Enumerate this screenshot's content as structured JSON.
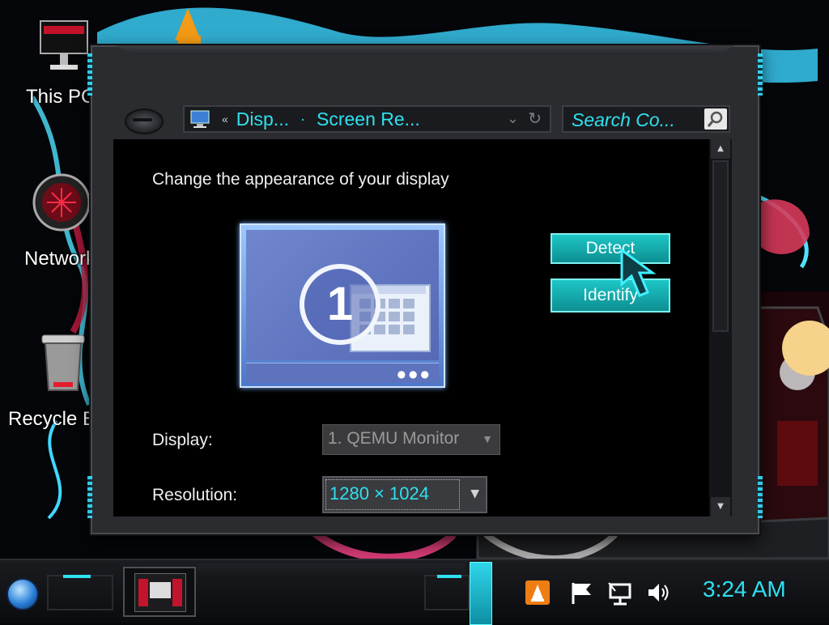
{
  "desktop": {
    "icons": [
      {
        "label": "This PC"
      },
      {
        "label": "Network"
      },
      {
        "label": "Recycle Bin"
      }
    ]
  },
  "window": {
    "address": {
      "overflow": "«",
      "crumb1": "Disp...",
      "separator": "·",
      "crumb2": "Screen Re..."
    },
    "search": {
      "placeholder": "Search Co..."
    },
    "heading": "Change the appearance of your display",
    "monitor": {
      "number": "1"
    },
    "detect_label": "Detect",
    "identify_label": "Identify",
    "display": {
      "label": "Display:",
      "value": "1. QEMU Monitor"
    },
    "resolution": {
      "label": "Resolution:",
      "value": "1280 × 1024"
    }
  },
  "taskbar": {
    "clock": "3:24 AM"
  },
  "colors": {
    "accent": "#2fe0f0",
    "button": "#14aab0",
    "window_bg": "#2b2c30",
    "content_bg": "#000000"
  }
}
